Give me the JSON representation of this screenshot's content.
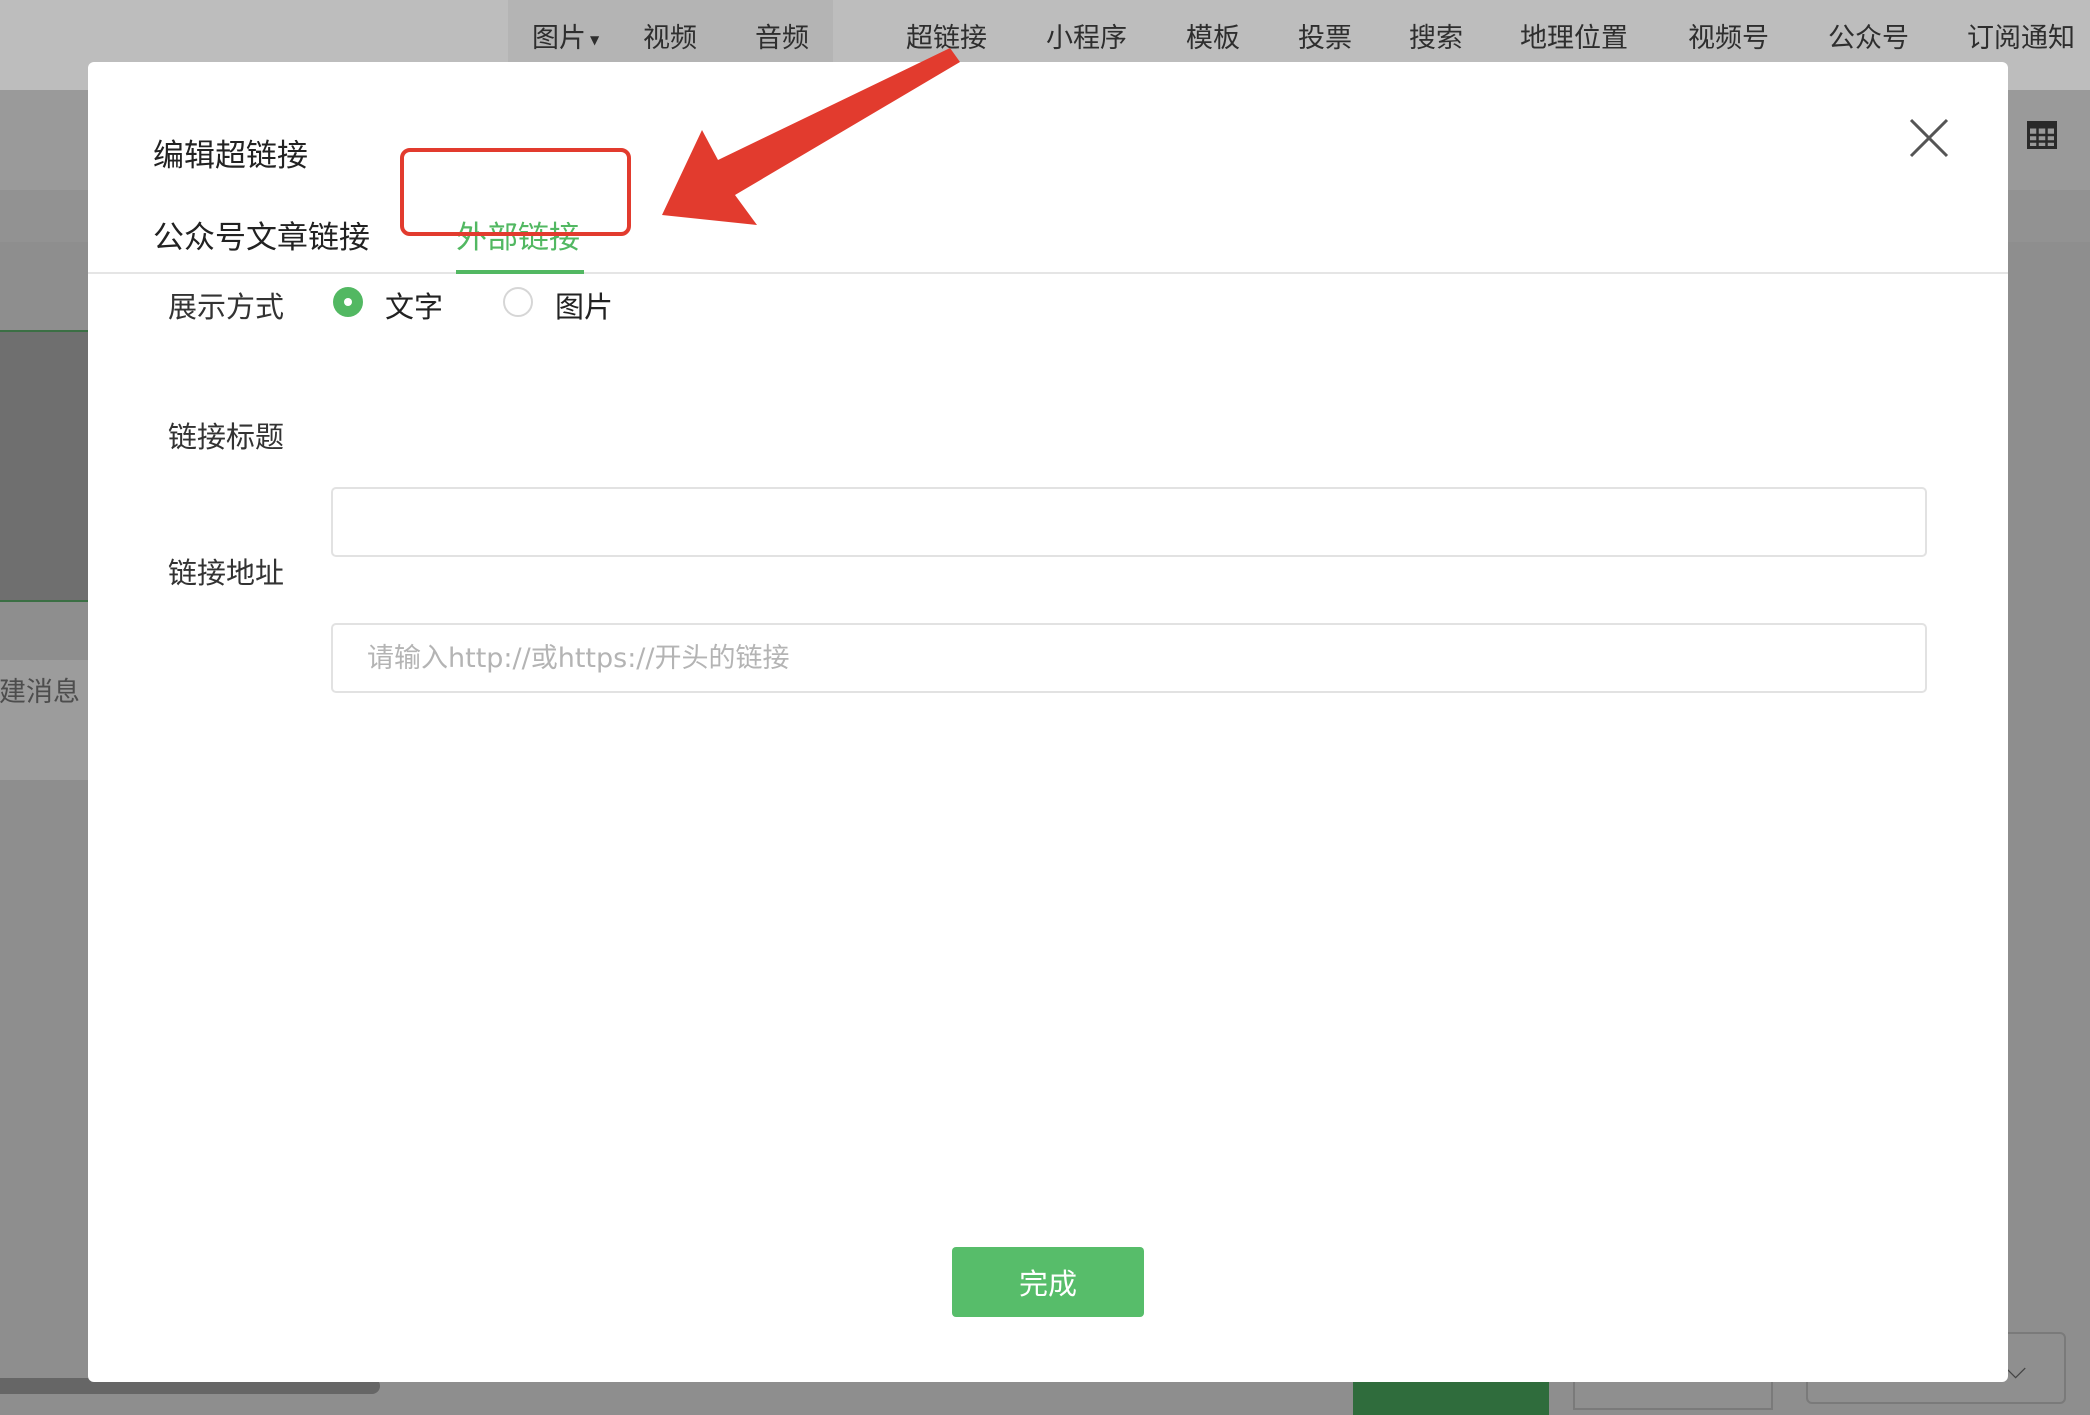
{
  "toolbar": {
    "items": [
      "图片",
      "视频",
      "音频",
      "超链接",
      "小程序",
      "模板",
      "投票",
      "搜索",
      "地理位置",
      "视频号",
      "公众号",
      "订阅通知"
    ]
  },
  "background": {
    "new_message_label": "新建消息"
  },
  "dialog": {
    "title": "编辑超链接",
    "tabs": [
      "公众号文章链接",
      "外部链接"
    ],
    "active_tab": "外部链接",
    "display_mode": {
      "label": "展示方式",
      "options": [
        "文字",
        "图片"
      ],
      "selected": "文字"
    },
    "link_title": {
      "label": "链接标题",
      "value": "",
      "placeholder": ""
    },
    "link_url": {
      "label": "链接地址",
      "value": "",
      "placeholder": "请输入http://或https://开头的链接"
    },
    "done_label": "完成"
  },
  "colors": {
    "accent_green": "#52b862",
    "annotation_red": "#e23b2e"
  },
  "icons": {
    "close": "close-icon",
    "table": "table-icon",
    "annotation": "arrow-icon"
  }
}
